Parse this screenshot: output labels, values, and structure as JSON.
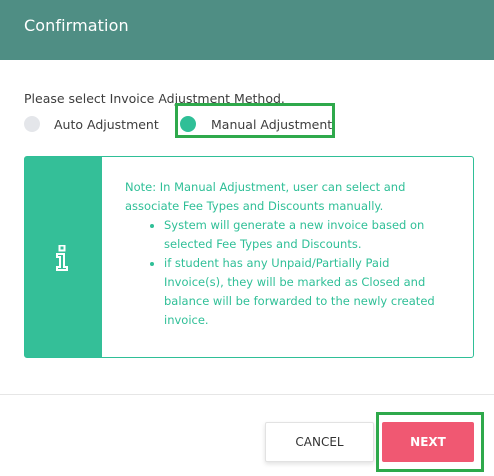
{
  "dialog": {
    "title": "Confirmation",
    "prompt": "Please select Invoice Adjustment Method.",
    "options": [
      {
        "label": "Auto Adjustment",
        "selected": false
      },
      {
        "label": "Manual Adjustment",
        "selected": true
      }
    ],
    "note": {
      "intro": "Note: In Manual Adjustment, user can select and associate Fee Types and Discounts manually.",
      "bullets": [
        "System will generate a new invoice based on selected Fee Types and Discounts.",
        "if student has any Unpaid/Partially Paid Invoice(s), they will be marked as Closed and balance will be forwarded to the newly created invoice."
      ],
      "icon": "info-icon"
    },
    "buttons": {
      "cancel": "CANCEL",
      "next": "NEXT"
    }
  },
  "colors": {
    "header_bg": "#4f8e84",
    "accent_teal": "#2fbf97",
    "next_button": "#f05872",
    "highlight": "#2ea94b"
  }
}
